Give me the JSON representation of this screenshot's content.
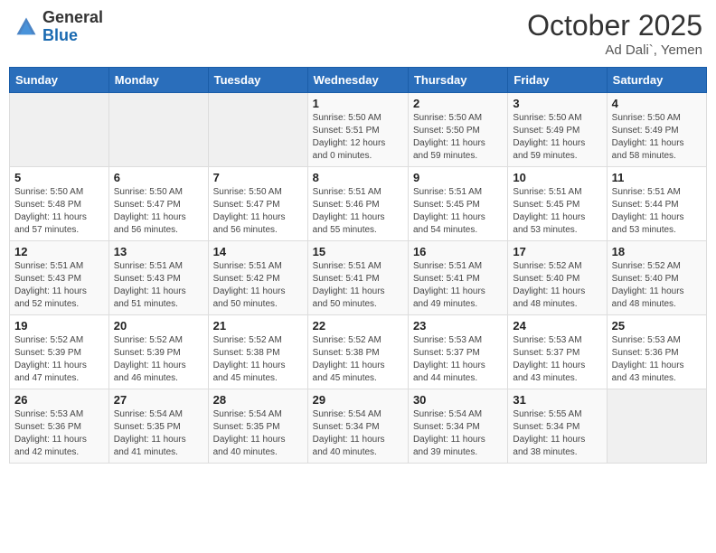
{
  "header": {
    "logo_general": "General",
    "logo_blue": "Blue",
    "month": "October 2025",
    "location": "Ad Dali`, Yemen"
  },
  "weekdays": [
    "Sunday",
    "Monday",
    "Tuesday",
    "Wednesday",
    "Thursday",
    "Friday",
    "Saturday"
  ],
  "weeks": [
    [
      {
        "day": "",
        "info": ""
      },
      {
        "day": "",
        "info": ""
      },
      {
        "day": "",
        "info": ""
      },
      {
        "day": "1",
        "info": "Sunrise: 5:50 AM\nSunset: 5:51 PM\nDaylight: 12 hours\nand 0 minutes."
      },
      {
        "day": "2",
        "info": "Sunrise: 5:50 AM\nSunset: 5:50 PM\nDaylight: 11 hours\nand 59 minutes."
      },
      {
        "day": "3",
        "info": "Sunrise: 5:50 AM\nSunset: 5:49 PM\nDaylight: 11 hours\nand 59 minutes."
      },
      {
        "day": "4",
        "info": "Sunrise: 5:50 AM\nSunset: 5:49 PM\nDaylight: 11 hours\nand 58 minutes."
      }
    ],
    [
      {
        "day": "5",
        "info": "Sunrise: 5:50 AM\nSunset: 5:48 PM\nDaylight: 11 hours\nand 57 minutes."
      },
      {
        "day": "6",
        "info": "Sunrise: 5:50 AM\nSunset: 5:47 PM\nDaylight: 11 hours\nand 56 minutes."
      },
      {
        "day": "7",
        "info": "Sunrise: 5:50 AM\nSunset: 5:47 PM\nDaylight: 11 hours\nand 56 minutes."
      },
      {
        "day": "8",
        "info": "Sunrise: 5:51 AM\nSunset: 5:46 PM\nDaylight: 11 hours\nand 55 minutes."
      },
      {
        "day": "9",
        "info": "Sunrise: 5:51 AM\nSunset: 5:45 PM\nDaylight: 11 hours\nand 54 minutes."
      },
      {
        "day": "10",
        "info": "Sunrise: 5:51 AM\nSunset: 5:45 PM\nDaylight: 11 hours\nand 53 minutes."
      },
      {
        "day": "11",
        "info": "Sunrise: 5:51 AM\nSunset: 5:44 PM\nDaylight: 11 hours\nand 53 minutes."
      }
    ],
    [
      {
        "day": "12",
        "info": "Sunrise: 5:51 AM\nSunset: 5:43 PM\nDaylight: 11 hours\nand 52 minutes."
      },
      {
        "day": "13",
        "info": "Sunrise: 5:51 AM\nSunset: 5:43 PM\nDaylight: 11 hours\nand 51 minutes."
      },
      {
        "day": "14",
        "info": "Sunrise: 5:51 AM\nSunset: 5:42 PM\nDaylight: 11 hours\nand 50 minutes."
      },
      {
        "day": "15",
        "info": "Sunrise: 5:51 AM\nSunset: 5:41 PM\nDaylight: 11 hours\nand 50 minutes."
      },
      {
        "day": "16",
        "info": "Sunrise: 5:51 AM\nSunset: 5:41 PM\nDaylight: 11 hours\nand 49 minutes."
      },
      {
        "day": "17",
        "info": "Sunrise: 5:52 AM\nSunset: 5:40 PM\nDaylight: 11 hours\nand 48 minutes."
      },
      {
        "day": "18",
        "info": "Sunrise: 5:52 AM\nSunset: 5:40 PM\nDaylight: 11 hours\nand 48 minutes."
      }
    ],
    [
      {
        "day": "19",
        "info": "Sunrise: 5:52 AM\nSunset: 5:39 PM\nDaylight: 11 hours\nand 47 minutes."
      },
      {
        "day": "20",
        "info": "Sunrise: 5:52 AM\nSunset: 5:39 PM\nDaylight: 11 hours\nand 46 minutes."
      },
      {
        "day": "21",
        "info": "Sunrise: 5:52 AM\nSunset: 5:38 PM\nDaylight: 11 hours\nand 45 minutes."
      },
      {
        "day": "22",
        "info": "Sunrise: 5:52 AM\nSunset: 5:38 PM\nDaylight: 11 hours\nand 45 minutes."
      },
      {
        "day": "23",
        "info": "Sunrise: 5:53 AM\nSunset: 5:37 PM\nDaylight: 11 hours\nand 44 minutes."
      },
      {
        "day": "24",
        "info": "Sunrise: 5:53 AM\nSunset: 5:37 PM\nDaylight: 11 hours\nand 43 minutes."
      },
      {
        "day": "25",
        "info": "Sunrise: 5:53 AM\nSunset: 5:36 PM\nDaylight: 11 hours\nand 43 minutes."
      }
    ],
    [
      {
        "day": "26",
        "info": "Sunrise: 5:53 AM\nSunset: 5:36 PM\nDaylight: 11 hours\nand 42 minutes."
      },
      {
        "day": "27",
        "info": "Sunrise: 5:54 AM\nSunset: 5:35 PM\nDaylight: 11 hours\nand 41 minutes."
      },
      {
        "day": "28",
        "info": "Sunrise: 5:54 AM\nSunset: 5:35 PM\nDaylight: 11 hours\nand 40 minutes."
      },
      {
        "day": "29",
        "info": "Sunrise: 5:54 AM\nSunset: 5:34 PM\nDaylight: 11 hours\nand 40 minutes."
      },
      {
        "day": "30",
        "info": "Sunrise: 5:54 AM\nSunset: 5:34 PM\nDaylight: 11 hours\nand 39 minutes."
      },
      {
        "day": "31",
        "info": "Sunrise: 5:55 AM\nSunset: 5:34 PM\nDaylight: 11 hours\nand 38 minutes."
      },
      {
        "day": "",
        "info": ""
      }
    ]
  ]
}
